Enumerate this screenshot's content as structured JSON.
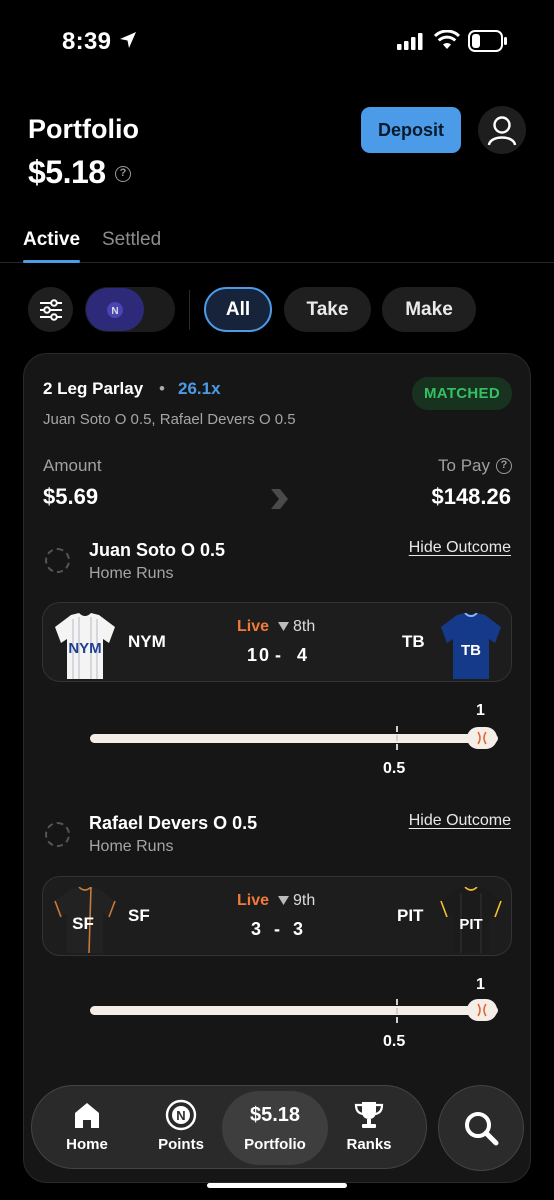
{
  "status_bar": {
    "time": "8:39"
  },
  "header": {
    "title": "Portfolio",
    "balance": "$5.18",
    "help_icon": "?",
    "deposit_label": "Deposit"
  },
  "tabs": [
    {
      "label": "Active"
    },
    {
      "label": "Settled"
    }
  ],
  "filters": {
    "all_label": "All",
    "take_label": "Take",
    "make_label": "Make",
    "toggle_logo": "N"
  },
  "card": {
    "title": "2 Leg Parlay",
    "separator": "•",
    "multiplier": "26.1x",
    "status": "MATCHED",
    "subtitle": "Juan Soto O 0.5, Rafael Devers O 0.5",
    "amount_label": "Amount",
    "amount_value": "$5.69",
    "topay_label": "To Pay",
    "topay_value": "$148.26",
    "legs": [
      {
        "title": "Juan Soto O 0.5",
        "stat": "Home Runs",
        "hide_label": "Hide Outcome",
        "home_team": "NYM",
        "away_team": "TB",
        "live_label": "Live",
        "inning": "8th",
        "score_home": "10",
        "score_sep": "-",
        "score_away": "4",
        "line_label": "0.5",
        "progress_label": "1",
        "progress_value": 1,
        "home_jersey_color": "#f4f4f4",
        "away_jersey_color": "#163a8a"
      },
      {
        "title": "Rafael Devers O 0.5",
        "stat": "Home Runs",
        "hide_label": "Hide Outcome",
        "home_team": "SF",
        "away_team": "PIT",
        "live_label": "Live",
        "inning": "9th",
        "score_home": "3",
        "score_sep": "-",
        "score_away": "3",
        "line_label": "0.5",
        "progress_label": "1",
        "progress_value": 1,
        "home_jersey_color": "#222222",
        "away_jersey_color": "#1b1b1b"
      }
    ]
  },
  "nav": {
    "items": [
      {
        "label": "Home",
        "icon": "home-icon"
      },
      {
        "label": "Points",
        "icon": "points-icon"
      },
      {
        "label": "Portfolio",
        "value": "$5.18"
      },
      {
        "label": "Ranks",
        "icon": "trophy-icon"
      }
    ],
    "search_icon": "search-icon"
  },
  "colors": {
    "accent": "#4b9be8",
    "matched": "#33c163",
    "live": "#ef7a3a"
  }
}
